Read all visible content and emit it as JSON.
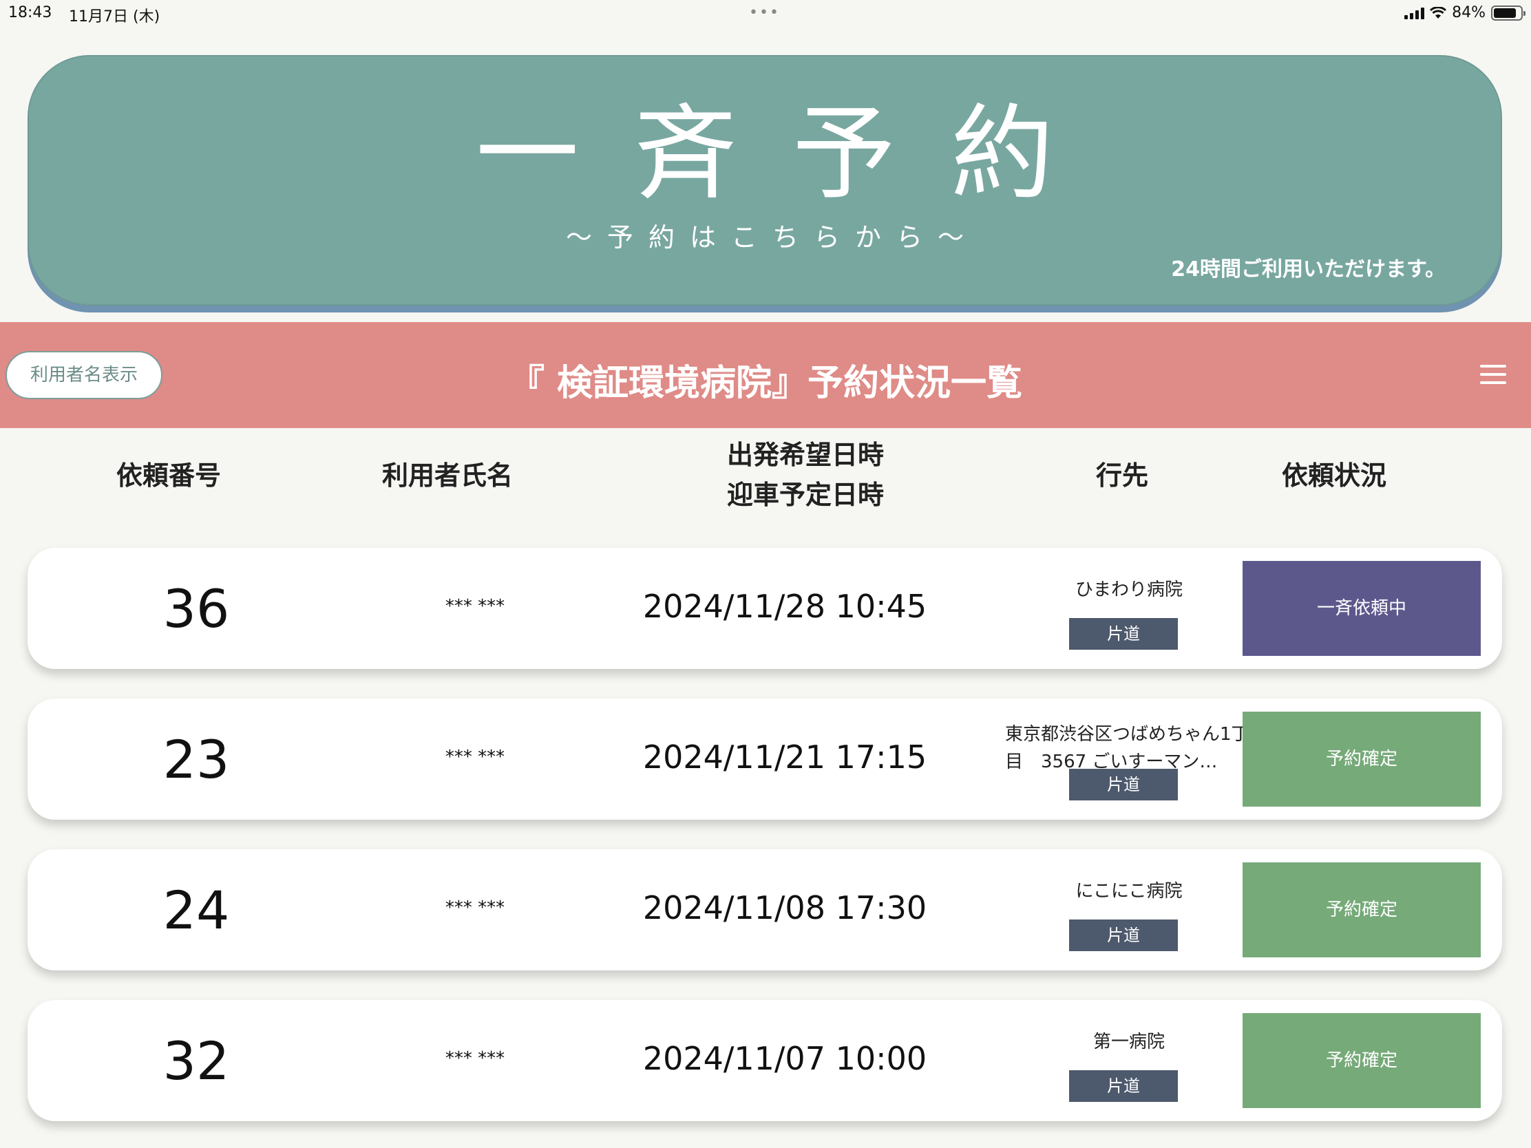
{
  "statusbar": {
    "time": "18:43",
    "date": "11月7日 (木)",
    "battery": "84%",
    "battery_level": 0.84,
    "multitask_dots": "•••"
  },
  "banner": {
    "title": "一斉予約",
    "subtitle": "～予約はこちらから～",
    "note": "24時間ご利用いただけます。"
  },
  "header": {
    "user_toggle_label": "利用者名表示",
    "title": "『 検証環境病院』予約状況一覧"
  },
  "columns": {
    "request_no": "依頼番号",
    "user_name": "利用者氏名",
    "departure_line1": "出発希望日時",
    "departure_line2": "迎車予定日時",
    "destination": "行先",
    "status": "依頼状況"
  },
  "rows": [
    {
      "id": "36",
      "name": "*** ***",
      "datetime": "2024/11/28 10:45",
      "destination": "ひまわり病院",
      "trip": "片道",
      "status": "一斉依頼中"
    },
    {
      "id": "23",
      "name": "*** ***",
      "datetime": "2024/11/21 17:15",
      "destination": "東京都渋谷区つばめちゃん1丁目　3567 ごいすーマン…",
      "trip": "片道",
      "status": "予約確定"
    },
    {
      "id": "24",
      "name": "*** ***",
      "datetime": "2024/11/08 17:30",
      "destination": "にこにこ病院",
      "trip": "片道",
      "status": "予約確定"
    },
    {
      "id": "32",
      "name": "*** ***",
      "datetime": "2024/11/07 10:00",
      "destination": "第一病院",
      "trip": "片道",
      "status": "予約確定"
    }
  ],
  "colors": {
    "banner": "#78a7a0",
    "header_bar": "#df8b87",
    "status_active": "#5d588c",
    "status_confirmed": "#76aa79",
    "trip_chip": "#4d596c"
  }
}
